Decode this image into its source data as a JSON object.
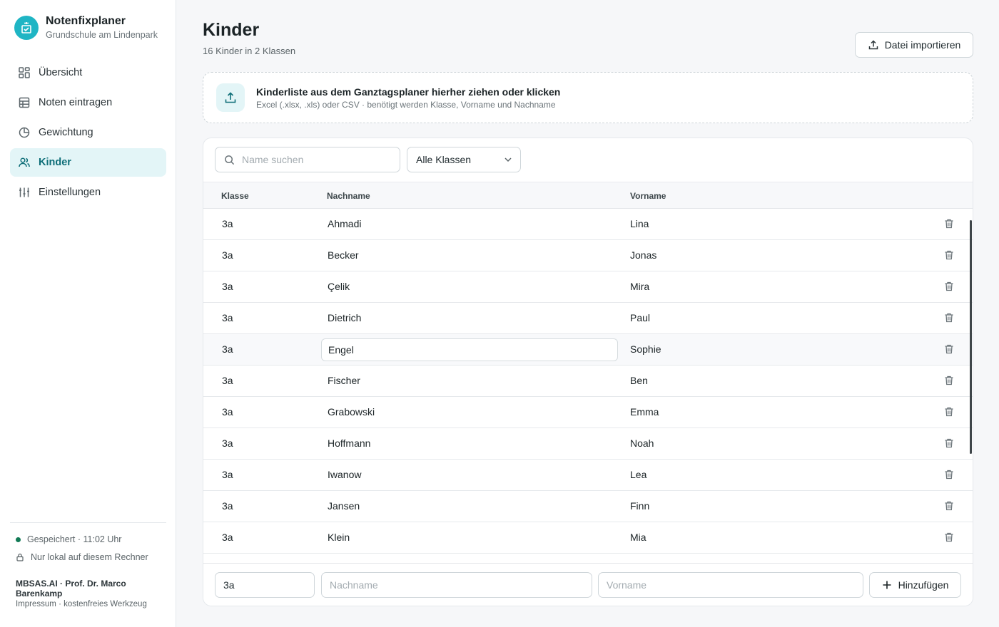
{
  "app": {
    "name": "Notenfixplaner",
    "school": "Grundschule am Lindenpark",
    "brand_color": "#1fb5c4",
    "accent_color": "#0e6e78"
  },
  "nav": [
    {
      "label": "Übersicht",
      "icon": "dashboard-grid-icon",
      "active": false
    },
    {
      "label": "Noten eintragen",
      "icon": "table-icon",
      "active": false
    },
    {
      "label": "Gewichtung",
      "icon": "pie-chart-icon",
      "active": false
    },
    {
      "label": "Kinder",
      "icon": "users-icon",
      "active": true
    },
    {
      "label": "Einstellungen",
      "icon": "sliders-icon",
      "active": false
    }
  ],
  "status": {
    "saved": "Gespeichert · 11:02 Uhr",
    "local": "Nur lokal auf diesem Rechner"
  },
  "credit": {
    "author": "MBSAS.AI · Prof. Dr. Marco Barenkamp",
    "links": "Impressum · kostenfreies Werkzeug"
  },
  "page": {
    "title": "Kinder",
    "subtitle": "16 Kinder in 2 Klassen",
    "import_label": "Datei importieren"
  },
  "dropzone": {
    "title": "Kinderliste aus dem Ganztagsplaner hierher ziehen oder klicken",
    "subtitle": "Excel (.xlsx, .xls) oder CSV · benötigt werden Klasse, Vorname und Nachname"
  },
  "filters": {
    "search_placeholder": "Name suchen",
    "class_selected": "Alle Klassen"
  },
  "table": {
    "headers": {
      "klasse": "Klasse",
      "nachname": "Nachname",
      "vorname": "Vorname"
    },
    "rows": [
      {
        "klasse": "3a",
        "nachname": "Ahmadi",
        "vorname": "Lina"
      },
      {
        "klasse": "3a",
        "nachname": "Becker",
        "vorname": "Jonas"
      },
      {
        "klasse": "3a",
        "nachname": "Çelik",
        "vorname": "Mira"
      },
      {
        "klasse": "3a",
        "nachname": "Dietrich",
        "vorname": "Paul"
      },
      {
        "klasse": "3a",
        "nachname": "Engel",
        "vorname": "Sophie"
      },
      {
        "klasse": "3a",
        "nachname": "Fischer",
        "vorname": "Ben"
      },
      {
        "klasse": "3a",
        "nachname": "Grabowski",
        "vorname": "Emma"
      },
      {
        "klasse": "3a",
        "nachname": "Hoffmann",
        "vorname": "Noah"
      },
      {
        "klasse": "3a",
        "nachname": "Iwanow",
        "vorname": "Lea"
      },
      {
        "klasse": "3a",
        "nachname": "Jansen",
        "vorname": "Finn"
      },
      {
        "klasse": "3a",
        "nachname": "Klein",
        "vorname": "Mia"
      }
    ]
  },
  "add": {
    "klasse_value": "3a",
    "nachname_placeholder": "Nachname",
    "vorname_placeholder": "Vorname",
    "button_label": "Hinzufügen"
  }
}
